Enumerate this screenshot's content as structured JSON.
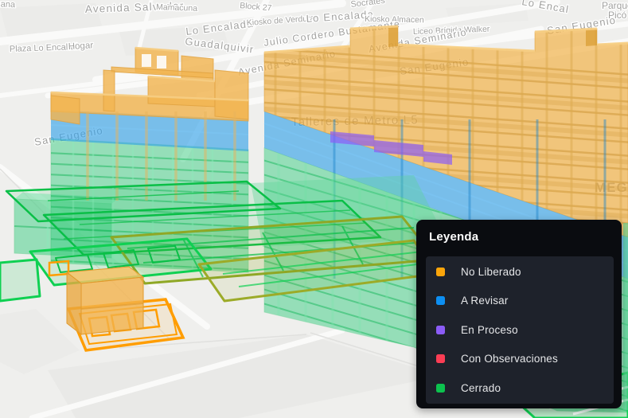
{
  "legend": {
    "title": "Leyenda",
    "items": [
      {
        "label": "No Liberado",
        "color": "#fba50a"
      },
      {
        "label": "A Revisar",
        "color": "#0d8ff2"
      },
      {
        "label": "En Proceso",
        "color": "#8b5cf6"
      },
      {
        "label": "Con Observaciones",
        "color": "#fb3d54"
      },
      {
        "label": "Cerrado",
        "color": "#0cc24e"
      }
    ]
  },
  "map": {
    "labels": [
      {
        "text": "lauana"
      },
      {
        "text": "Avenida Salvador"
      },
      {
        "text": "Mamacuna"
      },
      {
        "text": "Block 27"
      },
      {
        "text": "Socrates"
      },
      {
        "text": "Lo Encalada"
      },
      {
        "text": "Guadalquivir"
      },
      {
        "text": "Plaza Lo Encalada"
      },
      {
        "text": "Hogar"
      },
      {
        "text": "Kiosko de Verduras"
      },
      {
        "text": "Lo Encalada"
      },
      {
        "text": "Kiosko Almacen"
      },
      {
        "text": "Liceo Brígida Walker"
      },
      {
        "text": "Julio Cordero Bustamante"
      },
      {
        "text": "Avenida Seminario"
      },
      {
        "text": "Avenida Seminario"
      },
      {
        "text": "San Eugenio"
      },
      {
        "text": "Parque"
      },
      {
        "text": "Picó"
      },
      {
        "text": "San Eugenio"
      },
      {
        "text": "San Eugenio"
      },
      {
        "text": "Talleres de Metro L5"
      },
      {
        "text": "MEGA TV"
      },
      {
        "text": "Lo Encal"
      }
    ]
  }
}
